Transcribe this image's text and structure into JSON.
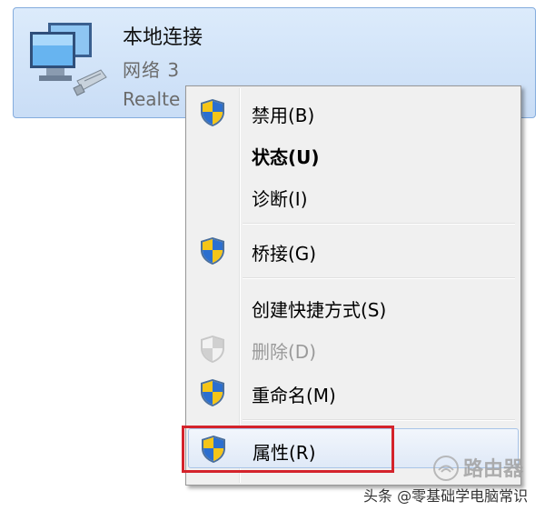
{
  "adapter": {
    "name": "本地连接",
    "network": "网络  3",
    "device": "Realte",
    "icon": "network-adapter-icon"
  },
  "context_menu": {
    "items": [
      {
        "label": "禁用(B)",
        "icon": "uac-shield-icon",
        "bold": false,
        "disabled": false
      },
      {
        "label": "状态(U)",
        "icon": "",
        "bold": true,
        "disabled": false
      },
      {
        "label": "诊断(I)",
        "icon": "",
        "bold": false,
        "disabled": false
      },
      {
        "label": "桥接(G)",
        "icon": "uac-shield-icon",
        "bold": false,
        "disabled": false
      },
      {
        "label": "创建快捷方式(S)",
        "icon": "",
        "bold": false,
        "disabled": false
      },
      {
        "label": "删除(D)",
        "icon": "uac-shield-icon",
        "bold": false,
        "disabled": true
      },
      {
        "label": "重命名(M)",
        "icon": "uac-shield-icon",
        "bold": false,
        "disabled": false
      },
      {
        "label": "属性(R)",
        "icon": "uac-shield-icon",
        "bold": false,
        "disabled": false,
        "selected": true
      }
    ]
  },
  "annotation": {
    "highlight_color": "#d4232b"
  },
  "watermark": {
    "router_text": "路由器",
    "author_text": "头条 @零基础学电脑常识"
  }
}
